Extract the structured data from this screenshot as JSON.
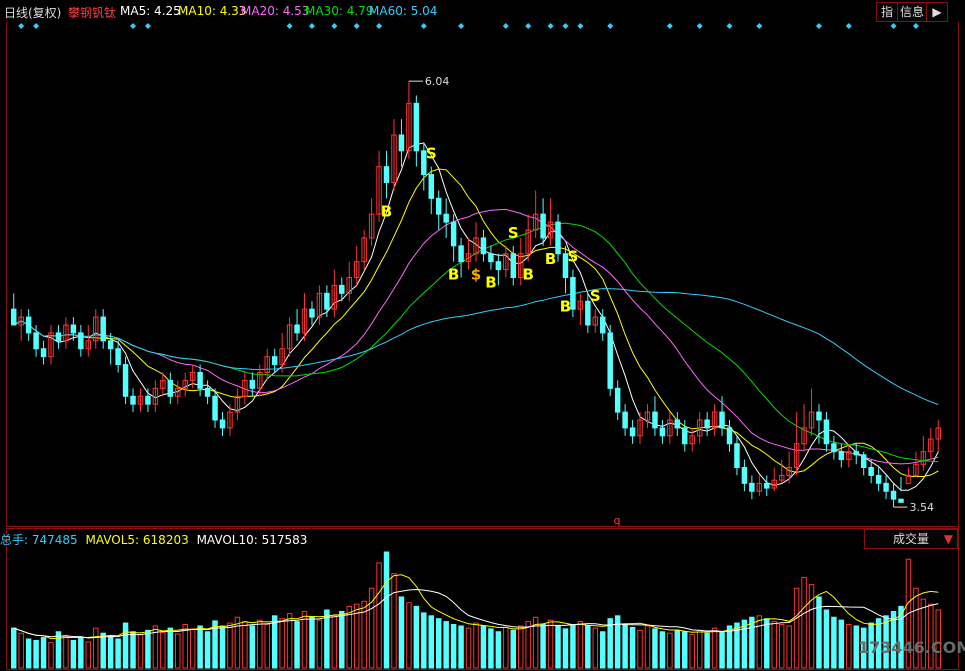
{
  "header": {
    "period": "日线(复权)",
    "stock_name": "攀钢钒钛",
    "ma_items": [
      {
        "label": "MA5: 4.25",
        "color": "#ffffff"
      },
      {
        "label": "MA10: 4.33",
        "color": "#ffff00"
      },
      {
        "label": "MA20: 4.53",
        "color": "#ff66ff"
      },
      {
        "label": "MA30: 4.79",
        "color": "#00dd00"
      },
      {
        "label": "MA60: 5.04",
        "color": "#33ccff"
      }
    ],
    "buttons": {
      "index": "指",
      "info": "信息",
      "nav": "▶"
    }
  },
  "colors": {
    "up": "#ff3232",
    "down": "#54ffff",
    "ma5": "#ffffff",
    "ma10": "#ffff00",
    "ma20": "#ff66ff",
    "ma30": "#00dd00",
    "ma60": "#33ccff",
    "frame": "#8a1010"
  },
  "price_panel": {
    "annotations": {
      "high": "6.04",
      "low": "3.54",
      "marker": "q"
    }
  },
  "volume_panel": {
    "items": [
      {
        "label": "总手: 747485",
        "color": "#dddddd",
        "value_color": "#33ccff"
      },
      {
        "label": "MAVOL5: 618203",
        "color": "#ffff00"
      },
      {
        "label": "MAVOL10: 517583",
        "color": "#ffffff"
      }
    ],
    "selector": "成交量",
    "watermark": "173446.COM"
  },
  "chart_data": {
    "type": "candlestick",
    "title": "攀钢钒钛",
    "ylim": [
      3.3,
      6.3
    ],
    "candles": [
      [
        4.6,
        4.5,
        4.7,
        4.5
      ],
      [
        4.5,
        4.55,
        4.6,
        4.4
      ],
      [
        4.55,
        4.45,
        4.6,
        4.4
      ],
      [
        4.45,
        4.35,
        4.5,
        4.3
      ],
      [
        4.35,
        4.3,
        4.4,
        4.25
      ],
      [
        4.3,
        4.45,
        4.5,
        4.25
      ],
      [
        4.45,
        4.4,
        4.5,
        4.35
      ],
      [
        4.4,
        4.5,
        4.55,
        4.35
      ],
      [
        4.5,
        4.45,
        4.55,
        4.4
      ],
      [
        4.45,
        4.35,
        4.5,
        4.3
      ],
      [
        4.35,
        4.4,
        4.5,
        4.3
      ],
      [
        4.4,
        4.55,
        4.6,
        4.35
      ],
      [
        4.55,
        4.4,
        4.6,
        4.35
      ],
      [
        4.4,
        4.35,
        4.45,
        4.25
      ],
      [
        4.35,
        4.25,
        4.4,
        4.2
      ],
      [
        4.25,
        4.05,
        4.3,
        4.0
      ],
      [
        4.05,
        4.0,
        4.1,
        3.95
      ],
      [
        4.0,
        4.05,
        4.1,
        3.95
      ],
      [
        4.05,
        4.0,
        4.1,
        3.95
      ],
      [
        4.0,
        4.1,
        4.15,
        3.95
      ],
      [
        4.1,
        4.15,
        4.2,
        4.05
      ],
      [
        4.15,
        4.05,
        4.2,
        4.0
      ],
      [
        4.05,
        4.1,
        4.15,
        4.0
      ],
      [
        4.1,
        4.15,
        4.2,
        4.05
      ],
      [
        4.15,
        4.2,
        4.25,
        4.1
      ],
      [
        4.2,
        4.1,
        4.25,
        4.05
      ],
      [
        4.1,
        4.05,
        4.15,
        4.0
      ],
      [
        4.05,
        3.9,
        4.1,
        3.85
      ],
      [
        3.9,
        3.85,
        3.95,
        3.8
      ],
      [
        3.85,
        3.95,
        4.0,
        3.8
      ],
      [
        3.95,
        4.05,
        4.1,
        3.9
      ],
      [
        4.05,
        4.15,
        4.2,
        4.0
      ],
      [
        4.15,
        4.1,
        4.2,
        4.05
      ],
      [
        4.1,
        4.2,
        4.25,
        4.05
      ],
      [
        4.2,
        4.3,
        4.35,
        4.15
      ],
      [
        4.3,
        4.25,
        4.35,
        4.2
      ],
      [
        4.25,
        4.35,
        4.45,
        4.2
      ],
      [
        4.35,
        4.5,
        4.55,
        4.3
      ],
      [
        4.5,
        4.45,
        4.6,
        4.4
      ],
      [
        4.45,
        4.6,
        4.7,
        4.4
      ],
      [
        4.6,
        4.55,
        4.65,
        4.5
      ],
      [
        4.55,
        4.7,
        4.75,
        4.5
      ],
      [
        4.7,
        4.6,
        4.75,
        4.55
      ],
      [
        4.6,
        4.75,
        4.85,
        4.55
      ],
      [
        4.75,
        4.7,
        4.8,
        4.65
      ],
      [
        4.7,
        4.8,
        4.9,
        4.65
      ],
      [
        4.8,
        4.9,
        5.0,
        4.75
      ],
      [
        4.9,
        5.05,
        5.1,
        4.85
      ],
      [
        5.05,
        5.2,
        5.3,
        5.0
      ],
      [
        5.2,
        5.5,
        5.6,
        5.15
      ],
      [
        5.5,
        5.4,
        5.6,
        5.3
      ],
      [
        5.4,
        5.7,
        5.8,
        5.35
      ],
      [
        5.7,
        5.6,
        5.8,
        5.5
      ],
      [
        5.6,
        5.9,
        6.04,
        5.55
      ],
      [
        5.9,
        5.6,
        5.95,
        5.5
      ],
      [
        5.6,
        5.45,
        5.65,
        5.35
      ],
      [
        5.45,
        5.3,
        5.5,
        5.2
      ],
      [
        5.3,
        5.2,
        5.35,
        5.1
      ],
      [
        5.2,
        5.15,
        5.3,
        5.05
      ],
      [
        5.15,
        5.0,
        5.2,
        4.9
      ],
      [
        5.0,
        4.9,
        5.05,
        4.8
      ],
      [
        4.9,
        4.95,
        5.05,
        4.85
      ],
      [
        4.95,
        5.05,
        5.15,
        4.9
      ],
      [
        5.05,
        4.95,
        5.1,
        4.9
      ],
      [
        4.95,
        4.9,
        5.0,
        4.85
      ],
      [
        4.9,
        4.85,
        4.95,
        4.75
      ],
      [
        4.85,
        4.95,
        5.0,
        4.8
      ],
      [
        4.95,
        4.8,
        5.0,
        4.75
      ],
      [
        4.8,
        4.95,
        5.05,
        4.75
      ],
      [
        4.95,
        5.1,
        5.2,
        4.9
      ],
      [
        5.1,
        5.2,
        5.35,
        5.05
      ],
      [
        5.2,
        5.05,
        5.3,
        5.0
      ],
      [
        5.05,
        5.15,
        5.3,
        5.0
      ],
      [
        5.15,
        4.95,
        5.2,
        4.9
      ],
      [
        4.95,
        4.8,
        5.0,
        4.7
      ],
      [
        4.8,
        4.6,
        4.85,
        4.55
      ],
      [
        4.6,
        4.65,
        4.7,
        4.5
      ],
      [
        4.65,
        4.5,
        4.7,
        4.45
      ],
      [
        4.5,
        4.55,
        4.6,
        4.45
      ],
      [
        4.55,
        4.45,
        4.6,
        4.4
      ],
      [
        4.45,
        4.1,
        4.5,
        4.05
      ],
      [
        4.1,
        3.95,
        4.15,
        3.9
      ],
      [
        3.95,
        3.85,
        4.0,
        3.8
      ],
      [
        3.85,
        3.8,
        3.9,
        3.75
      ],
      [
        3.8,
        3.9,
        3.95,
        3.75
      ],
      [
        3.9,
        3.95,
        4.0,
        3.85
      ],
      [
        3.95,
        3.85,
        4.05,
        3.8
      ],
      [
        3.85,
        3.8,
        3.9,
        3.75
      ],
      [
        3.8,
        3.9,
        3.95,
        3.75
      ],
      [
        3.9,
        3.85,
        3.95,
        3.8
      ],
      [
        3.85,
        3.75,
        3.9,
        3.7
      ],
      [
        3.75,
        3.8,
        3.85,
        3.7
      ],
      [
        3.8,
        3.9,
        3.95,
        3.75
      ],
      [
        3.9,
        3.85,
        3.95,
        3.8
      ],
      [
        3.85,
        3.95,
        4.0,
        3.8
      ],
      [
        3.95,
        3.85,
        4.05,
        3.8
      ],
      [
        3.85,
        3.75,
        3.9,
        3.7
      ],
      [
        3.75,
        3.6,
        3.8,
        3.55
      ],
      [
        3.6,
        3.5,
        3.65,
        3.45
      ],
      [
        3.5,
        3.45,
        3.55,
        3.4
      ],
      [
        3.45,
        3.5,
        3.55,
        3.42
      ],
      [
        3.5,
        3.47,
        3.55,
        3.42
      ],
      [
        3.47,
        3.52,
        3.6,
        3.45
      ],
      [
        3.52,
        3.55,
        3.65,
        3.5
      ],
      [
        3.55,
        3.6,
        3.7,
        3.5
      ],
      [
        3.6,
        3.75,
        3.95,
        3.55
      ],
      [
        3.75,
        3.85,
        4.0,
        3.7
      ],
      [
        3.85,
        3.95,
        4.1,
        3.8
      ],
      [
        3.95,
        3.9,
        4.0,
        3.75
      ],
      [
        3.9,
        3.75,
        3.95,
        3.7
      ],
      [
        3.75,
        3.7,
        3.8,
        3.65
      ],
      [
        3.7,
        3.65,
        3.75,
        3.6
      ],
      [
        3.65,
        3.7,
        3.75,
        3.6
      ],
      [
        3.7,
        3.68,
        3.75,
        3.62
      ],
      [
        3.68,
        3.6,
        3.7,
        3.55
      ],
      [
        3.6,
        3.55,
        3.65,
        3.5
      ],
      [
        3.55,
        3.5,
        3.6,
        3.45
      ],
      [
        3.5,
        3.45,
        3.55,
        3.4
      ],
      [
        3.45,
        3.4,
        3.5,
        3.35
      ],
      [
        3.4,
        3.38,
        3.45,
        3.54
      ],
      [
        3.5,
        3.55,
        3.6,
        3.54
      ],
      [
        3.55,
        3.62,
        3.7,
        3.54
      ],
      [
        3.62,
        3.7,
        3.8,
        3.58
      ],
      [
        3.7,
        3.78,
        3.85,
        3.65
      ],
      [
        3.78,
        3.85,
        3.9,
        3.7
      ]
    ],
    "volumes": [
      55,
      48,
      40,
      38,
      42,
      35,
      50,
      45,
      38,
      42,
      36,
      55,
      48,
      44,
      40,
      62,
      50,
      46,
      52,
      58,
      49,
      55,
      47,
      60,
      54,
      58,
      50,
      65,
      58,
      62,
      70,
      64,
      58,
      66,
      60,
      72,
      68,
      75,
      64,
      78,
      70,
      66,
      80,
      72,
      78,
      85,
      88,
      92,
      110,
      145,
      160,
      130,
      98,
      90,
      85,
      76,
      72,
      68,
      64,
      60,
      58,
      55,
      62,
      58,
      54,
      50,
      56,
      52,
      58,
      64,
      70,
      60,
      66,
      58,
      54,
      60,
      64,
      58,
      55,
      50,
      68,
      72,
      60,
      56,
      52,
      58,
      54,
      50,
      48,
      52,
      50,
      46,
      52,
      48,
      55,
      50,
      58,
      62,
      66,
      70,
      72,
      68,
      64,
      60,
      58,
      110,
      125,
      115,
      98,
      80,
      70,
      66,
      60,
      58,
      55,
      62,
      68,
      72,
      78,
      85,
      150,
      110,
      95,
      88,
      80
    ],
    "ma_periods": [
      5,
      10,
      20,
      30,
      60
    ],
    "signals": [
      {
        "i": 50,
        "label": "B",
        "side": "buy"
      },
      {
        "i": 56,
        "label": "S",
        "side": "sell"
      },
      {
        "i": 59,
        "label": "B",
        "side": "buy"
      },
      {
        "i": 62,
        "label": "$",
        "side": "buy"
      },
      {
        "i": 64,
        "label": "B",
        "side": "buy"
      },
      {
        "i": 67,
        "label": "S",
        "side": "sell"
      },
      {
        "i": 69,
        "label": "B",
        "side": "buy"
      },
      {
        "i": 72,
        "label": "B",
        "side": "buy"
      },
      {
        "i": 74,
        "label": "B",
        "side": "buy"
      },
      {
        "i": 75,
        "label": "S",
        "side": "sell"
      },
      {
        "i": 78,
        "label": "S",
        "side": "sell"
      }
    ]
  }
}
